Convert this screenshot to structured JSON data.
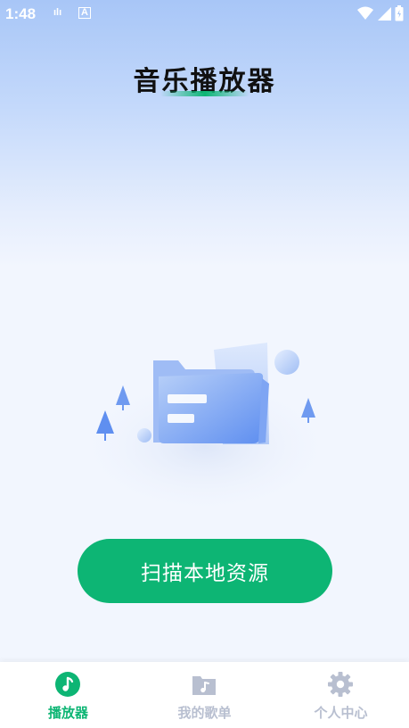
{
  "status_bar": {
    "time": "1:48",
    "notif1": "ılı",
    "notif2": "A",
    "battery_glyph": "▮"
  },
  "page": {
    "title": "音乐播放器"
  },
  "main": {
    "scan_button_label": "扫描本地资源"
  },
  "tabbar": {
    "tabs": [
      {
        "label": "播放器",
        "icon": "music-note-icon",
        "active": true
      },
      {
        "label": "我的歌单",
        "icon": "playlist-folder-icon",
        "active": false
      },
      {
        "label": "个人中心",
        "icon": "gear-icon",
        "active": false
      }
    ]
  },
  "colors": {
    "accent": "#0db574",
    "inactive": "#b8bfd0",
    "background": "#f2f6fe"
  }
}
